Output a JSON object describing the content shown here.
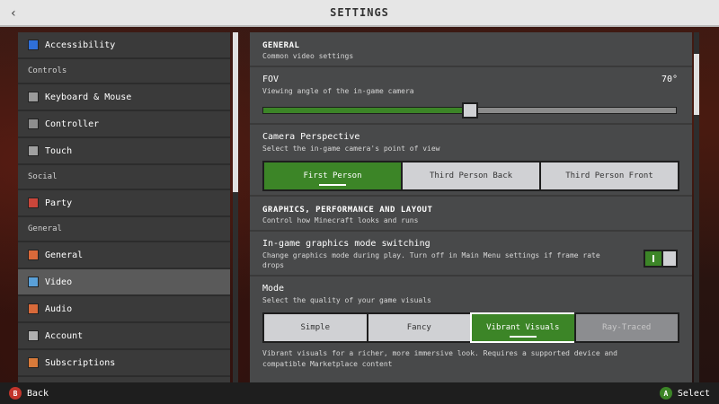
{
  "header": {
    "title": "SETTINGS",
    "back_glyph": "‹"
  },
  "sidebar": {
    "top_items": [
      {
        "label": "Accessibility",
        "icon": "accessibility-icon"
      }
    ],
    "sections": [
      {
        "label": "Controls",
        "items": [
          {
            "label": "Keyboard & Mouse",
            "icon": "keyboard-icon"
          },
          {
            "label": "Controller",
            "icon": "controller-icon"
          },
          {
            "label": "Touch",
            "icon": "touch-icon"
          }
        ]
      },
      {
        "label": "Social",
        "items": [
          {
            "label": "Party",
            "icon": "party-icon"
          }
        ]
      },
      {
        "label": "General",
        "items": [
          {
            "label": "General",
            "icon": "general-icon"
          },
          {
            "label": "Video",
            "icon": "video-icon",
            "selected": true
          },
          {
            "label": "Audio",
            "icon": "audio-icon"
          },
          {
            "label": "Account",
            "icon": "account-icon"
          },
          {
            "label": "Subscriptions",
            "icon": "subscriptions-icon"
          }
        ]
      }
    ]
  },
  "main": {
    "general": {
      "title": "GENERAL",
      "subtitle": "Common video settings"
    },
    "fov": {
      "title": "FOV",
      "desc": "Viewing angle of the in-game camera",
      "value_label": "70°",
      "fill_fraction": 0.5
    },
    "camera": {
      "title": "Camera Perspective",
      "desc": "Select the in-game camera's point of view",
      "options": [
        "First Person",
        "Third Person Back",
        "Third Person Front"
      ],
      "selected": 0
    },
    "graphics": {
      "title": "GRAPHICS, PERFORMANCE AND LAYOUT",
      "subtitle": "Control how Minecraft looks and runs"
    },
    "switching": {
      "title": "In-game graphics mode switching",
      "desc": "Change graphics mode during play. Turn off in Main Menu settings if frame rate drops",
      "enabled": true
    },
    "mode": {
      "title": "Mode",
      "desc": "Select the quality of your game visuals",
      "options": [
        "Simple",
        "Fancy",
        "Vibrant Visuals",
        "Ray-Traced"
      ],
      "selected": 2,
      "disabled": [
        3
      ],
      "footnote": "Vibrant visuals for a richer, more immersive look. Requires a supported device and compatible Marketplace content"
    }
  },
  "footer": {
    "back": {
      "key": "B",
      "label": "Back"
    },
    "select": {
      "key": "A",
      "label": "Select"
    }
  },
  "colors": {
    "accent_green": "#3c8527",
    "button_b": "#c2352c",
    "button_a": "#3c8527"
  }
}
